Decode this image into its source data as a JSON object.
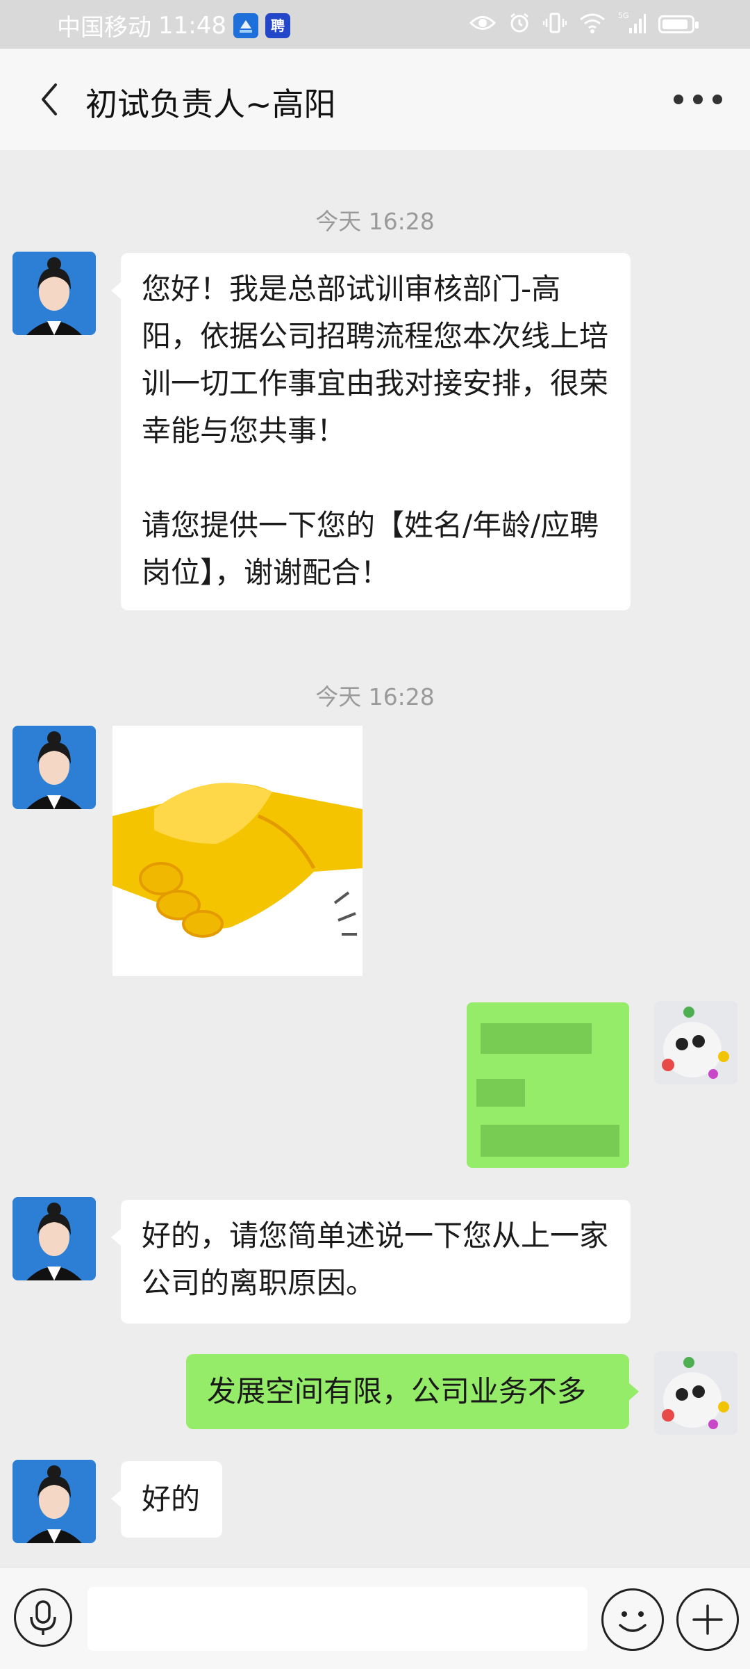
{
  "status_bar": {
    "carrier": "中国移动",
    "time": "11:48",
    "app_icons": [
      "zhaopin-app-icon",
      "pin-app-icon"
    ],
    "app_icon2_text": "聘",
    "network_label": "5G"
  },
  "header": {
    "title": "初试负责人~高阳"
  },
  "messages": [
    {
      "type": "timestamp",
      "text": "今天 16:28"
    },
    {
      "type": "text",
      "side": "left",
      "text": "您好！我是总部试训审核部门-高阳，依据公司招聘流程您本次线上培训一切工作事宜由我对接安排，很荣幸能与您共事！\n\n请您提供一下您的【姓名/年龄/应聘岗位】，谢谢配合！"
    },
    {
      "type": "timestamp",
      "text": "今天 16:28"
    },
    {
      "type": "sticker",
      "side": "left",
      "icon": "handshake-sticker"
    },
    {
      "type": "text",
      "side": "right",
      "text": "",
      "blurred": true
    },
    {
      "type": "text",
      "side": "left",
      "text": "好的，请您简单述说一下您从上一家公司的离职原因。"
    },
    {
      "type": "text",
      "side": "right",
      "text": "发展空间有限，公司业务不多"
    },
    {
      "type": "text",
      "side": "left",
      "text": "好的"
    }
  ],
  "input_bar": {
    "voice_icon": "microphone-icon",
    "emoji_icon": "smiley-icon",
    "plus_icon": "plus-icon",
    "input_value": ""
  },
  "colors": {
    "bubble_self": "#95ec69",
    "bubble_other": "#ffffff",
    "chat_bg": "#ededed"
  }
}
